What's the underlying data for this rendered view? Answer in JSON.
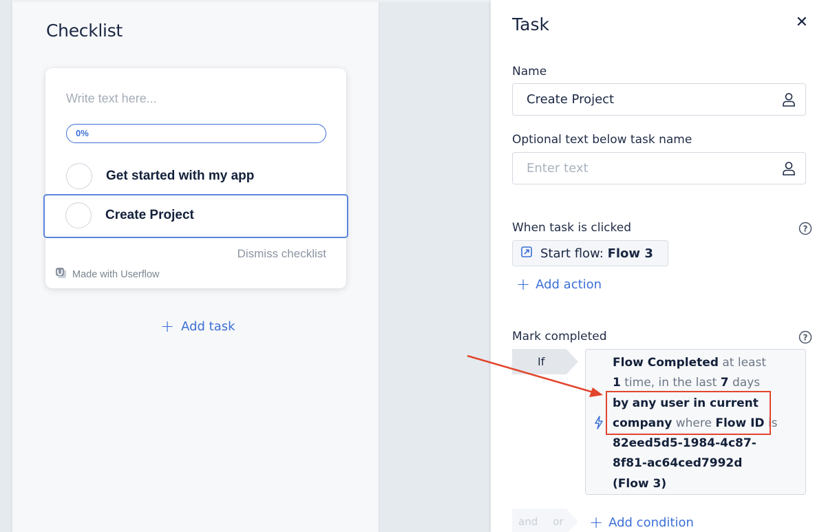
{
  "checklist": {
    "title": "Checklist",
    "intro_placeholder": "Write text here...",
    "progress_percent": 0,
    "progress_label": "0%",
    "tasks": [
      {
        "label": "Get started with my app",
        "selected": false
      },
      {
        "label": "Create Project",
        "selected": true
      }
    ],
    "dismiss_label": "Dismiss checklist",
    "branding": "Made with Userflow",
    "add_task_label": "Add task"
  },
  "task_panel": {
    "title": "Task",
    "close_icon": "close-icon",
    "name_label": "Name",
    "name_value": "Create Project",
    "optional_label": "Optional text below task name",
    "optional_placeholder": "Enter text",
    "when_clicked_label": "When task is clicked",
    "action": {
      "prefix": "Start flow:",
      "flow": "Flow 3"
    },
    "add_action_label": "Add action",
    "mark_completed_label": "Mark completed",
    "if_label": "If",
    "condition": {
      "event": "Flow Completed",
      "t1": "at least",
      "count": "1",
      "t2": "time, in the last",
      "days": "7",
      "t3": "days",
      "by": "by",
      "scope": "any user in current company",
      "t4": "where",
      "property": "Flow ID",
      "t5": "is",
      "value": "82eed5d5-1984-4c87-8f81-ac64ced7992d (Flow 3)"
    },
    "and_label": "and",
    "or_label": "or",
    "add_condition_label": "Add condition"
  },
  "colors": {
    "accent": "#3b6fd6",
    "annotation": "#e2452b"
  }
}
